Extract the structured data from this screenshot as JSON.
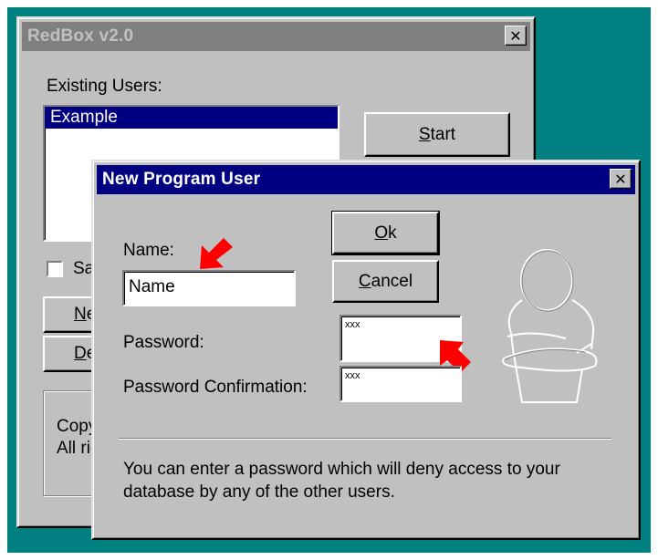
{
  "back_window": {
    "title": "RedBox v2.0",
    "close_symbol": "✕",
    "existing_users_label": "Existing Users:",
    "users": [
      "Example"
    ],
    "start_button": {
      "label_pre": "",
      "mnemonic": "S",
      "label_post": "tart"
    },
    "checkbox_partial": "Sa",
    "new_button": {
      "mnemonic": "N",
      "label_post": "ew"
    },
    "delete_button": {
      "mnemonic": "D",
      "label_post": "elete"
    },
    "copyright_line1": "Copyright",
    "copyright_line2": "All rights"
  },
  "dialog": {
    "title": "New Program User",
    "close_symbol": "✕",
    "name_label": "Name:",
    "name_value": "Name",
    "password_label": "Password:",
    "password_value": "xxx",
    "password_confirm_label": "Password Confirmation:",
    "password_confirm_value": "xxx",
    "ok_button": {
      "mnemonic": "O",
      "label_post": "k"
    },
    "cancel_button": {
      "mnemonic": "C",
      "label_post": "ancel"
    },
    "hint_line1": "You can enter a password which will deny access to your",
    "hint_line2": "database by any of the other users."
  },
  "icons": {
    "user_figure": "person-arms-crossed-icon",
    "arrow_name": "red-arrow-icon",
    "arrow_password": "red-arrow-icon"
  },
  "colors": {
    "desktop": "#008080",
    "face": "#c0c0c0",
    "active_title": "#000080",
    "inactive_title": "#808080",
    "selection": "#000080",
    "arrow": "#ff0000"
  }
}
